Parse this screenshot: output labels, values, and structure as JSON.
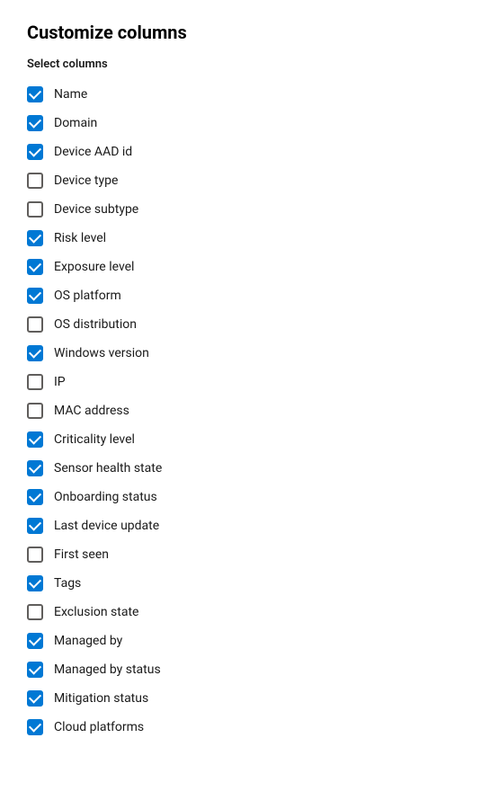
{
  "title": "Customize columns",
  "section_label": "Select columns",
  "columns": [
    {
      "id": "name",
      "label": "Name",
      "checked": true
    },
    {
      "id": "domain",
      "label": "Domain",
      "checked": true
    },
    {
      "id": "device-aad-id",
      "label": "Device AAD id",
      "checked": true
    },
    {
      "id": "device-type",
      "label": "Device type",
      "checked": false
    },
    {
      "id": "device-subtype",
      "label": "Device subtype",
      "checked": false
    },
    {
      "id": "risk-level",
      "label": "Risk level",
      "checked": true
    },
    {
      "id": "exposure-level",
      "label": "Exposure level",
      "checked": true
    },
    {
      "id": "os-platform",
      "label": "OS platform",
      "checked": true
    },
    {
      "id": "os-distribution",
      "label": "OS distribution",
      "checked": false
    },
    {
      "id": "windows-version",
      "label": "Windows version",
      "checked": true
    },
    {
      "id": "ip",
      "label": "IP",
      "checked": false
    },
    {
      "id": "mac-address",
      "label": "MAC address",
      "checked": false
    },
    {
      "id": "criticality-level",
      "label": "Criticality level",
      "checked": true
    },
    {
      "id": "sensor-health-state",
      "label": "Sensor health state",
      "checked": true
    },
    {
      "id": "onboarding-status",
      "label": "Onboarding status",
      "checked": true
    },
    {
      "id": "last-device-update",
      "label": "Last device update",
      "checked": true
    },
    {
      "id": "first-seen",
      "label": "First seen",
      "checked": false
    },
    {
      "id": "tags",
      "label": "Tags",
      "checked": true
    },
    {
      "id": "exclusion-state",
      "label": "Exclusion state",
      "checked": false
    },
    {
      "id": "managed-by",
      "label": "Managed by",
      "checked": true
    },
    {
      "id": "managed-by-status",
      "label": "Managed by status",
      "checked": true
    },
    {
      "id": "mitigation-status",
      "label": "Mitigation status",
      "checked": true
    },
    {
      "id": "cloud-platforms",
      "label": "Cloud platforms",
      "checked": true
    }
  ]
}
